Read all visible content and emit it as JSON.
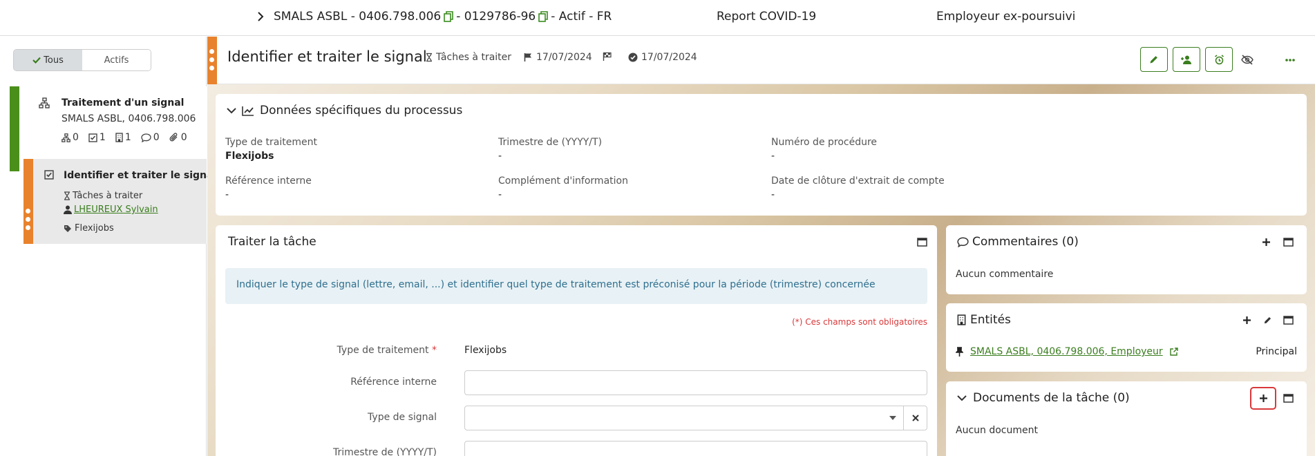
{
  "topbar": {
    "chevron_icon": "chevron-right",
    "org": "SMALS ASBL - 0406.798.006",
    "sep1": "- 0129786-96",
    "status": "- Actif - FR",
    "report": "Report COVID-19",
    "employer": "Employeur ex-poursuivi"
  },
  "sidebar": {
    "filter": {
      "all": "Tous",
      "active": "Actifs"
    },
    "process": {
      "title": "Traitement d'un signal",
      "subtitle": "SMALS ASBL, 0406.798.006",
      "counts": {
        "subprocess": "0",
        "tasks": "1",
        "entities": "1",
        "comments": "0",
        "links": "0"
      }
    },
    "task": {
      "title": "Identifier et traiter le signal",
      "status": "Tâches à traiter",
      "assignee": "LHEUREUX Sylvain",
      "tag": "Flexijobs"
    }
  },
  "task_header": {
    "title": "Identifier et traiter le signal",
    "status": "Tâches à traiter",
    "due_date": "17/07/2024",
    "done_date": "17/07/2024"
  },
  "process_data": {
    "title": "Données spécifiques du processus",
    "fields": [
      {
        "label": "Type de traitement",
        "value": "Flexijobs"
      },
      {
        "label": "Trimestre de (YYYY/T)",
        "value": "-"
      },
      {
        "label": "Numéro de procédure",
        "value": "-"
      },
      {
        "label": "Référence interne",
        "value": "-"
      },
      {
        "label": "Complément d'information",
        "value": "-"
      },
      {
        "label": "Date de clôture d'extrait de compte",
        "value": "-"
      }
    ]
  },
  "task_form": {
    "title": "Traiter la tâche",
    "info": "Indiquer le type de signal (lettre, email, ...) et identifier quel type de traitement est préconisé pour la période (trimestre) concernée",
    "required_note": "(*) Ces champs sont obligatoires",
    "fields": {
      "type_traitement_label": "Type de traitement",
      "type_traitement_value": "Flexijobs",
      "reference_label": "Référence interne",
      "reference_value": "",
      "signal_label": "Type de signal",
      "signal_value": "",
      "trimestre_label": "Trimestre de (YYYY/T)"
    }
  },
  "comments": {
    "title": "Commentaires (0)",
    "empty": "Aucun commentaire"
  },
  "entities": {
    "title": "Entités",
    "link": "SMALS ASBL, 0406.798.006, Employeur",
    "role": "Principal"
  },
  "documents": {
    "title": "Documents de la tâche (0)",
    "empty": "Aucun document"
  },
  "colors": {
    "green": "#3a7d1e",
    "orange": "#e8822c",
    "sidebar_green": "#4b8f1b",
    "info_bg": "#e8f1f5",
    "required": "#d9383a"
  }
}
